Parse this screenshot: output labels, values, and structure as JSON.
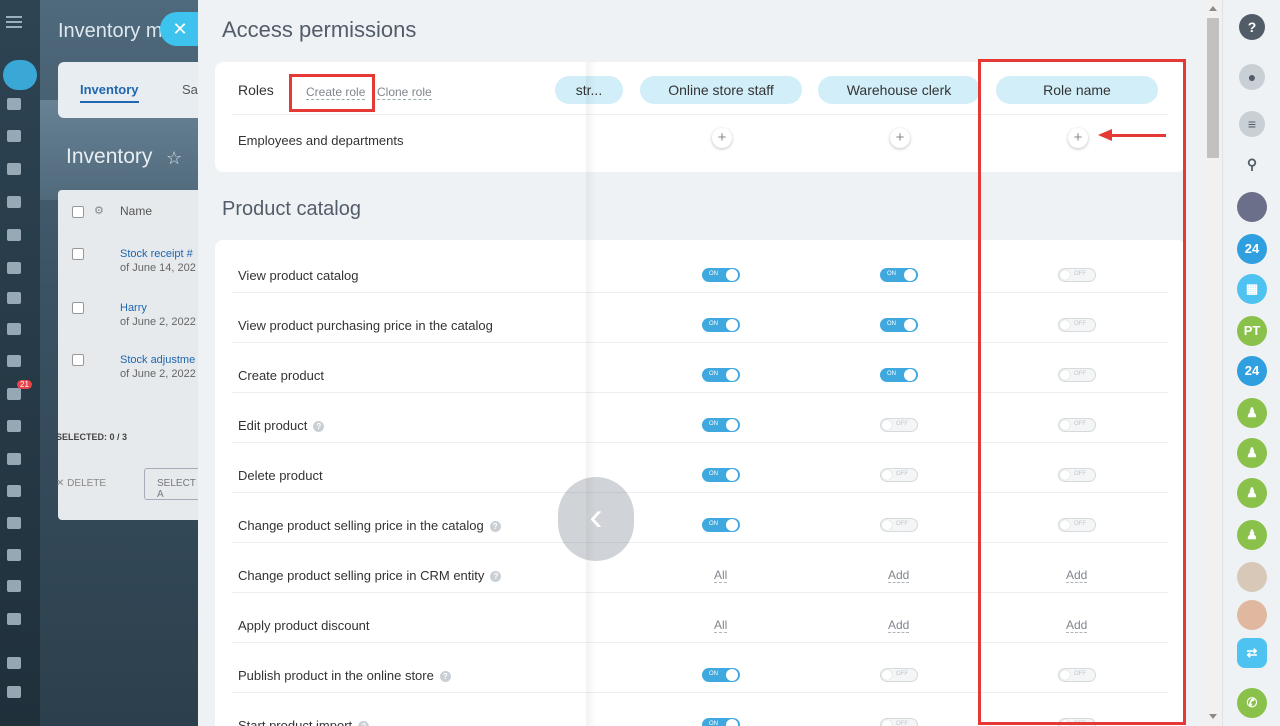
{
  "background": {
    "window_title": "Inventory m",
    "tabs": [
      "Inventory",
      "Sa"
    ],
    "page_title": "Inventory",
    "grid_header": "Name",
    "rows": [
      {
        "title": "Stock receipt #",
        "date": "of June 14, 202"
      },
      {
        "title": "Harry",
        "date": "of June 2, 2022"
      },
      {
        "title": "Stock adjustme",
        "date": "of June 2, 2022"
      }
    ],
    "selected": "SELECTED: 0 / 3",
    "delete": "DELETE",
    "select": "SELECT A",
    "badge": "21"
  },
  "panel": {
    "title": "Access permissions",
    "roles_label": "Roles",
    "create_role": "Create role",
    "clone_role": "Clone role",
    "roles": [
      "str...",
      "Online store staff",
      "Warehouse clerk",
      "Role name"
    ],
    "employees_label": "Employees and departments",
    "add_symbol": "+",
    "section_title": "Product catalog",
    "permissions": [
      {
        "label": "View product catalog",
        "help": false,
        "values": [
          "on",
          "on",
          "off"
        ]
      },
      {
        "label": "View product purchasing price in the catalog",
        "help": false,
        "values": [
          "on",
          "on",
          "off"
        ]
      },
      {
        "label": "Create product",
        "help": false,
        "values": [
          "on",
          "on",
          "off"
        ]
      },
      {
        "label": "Edit product",
        "help": true,
        "values": [
          "on",
          "off",
          "off"
        ]
      },
      {
        "label": "Delete product",
        "help": false,
        "values": [
          "on",
          "off",
          "off"
        ]
      },
      {
        "label": "Change product selling price in the catalog",
        "help": true,
        "values": [
          "on",
          "off",
          "off"
        ]
      },
      {
        "label": "Change product selling price in CRM entity",
        "help": true,
        "values": [
          "All",
          "Add",
          "Add"
        ]
      },
      {
        "label": "Apply product discount",
        "help": false,
        "values": [
          "All",
          "Add",
          "Add"
        ]
      },
      {
        "label": "Publish product in the online store",
        "help": true,
        "values": [
          "on",
          "off",
          "off"
        ]
      },
      {
        "label": "Start product import",
        "help": true,
        "values": [
          "on",
          "off",
          "off"
        ]
      }
    ]
  },
  "right_rail": {
    "help": "?",
    "avatars": [
      "24",
      "PT",
      "24"
    ]
  },
  "colors": {
    "toggle_on": "#3fa8df",
    "role_pill": "#d2eef9",
    "highlight": "#e53935",
    "link": "#2067b0"
  }
}
